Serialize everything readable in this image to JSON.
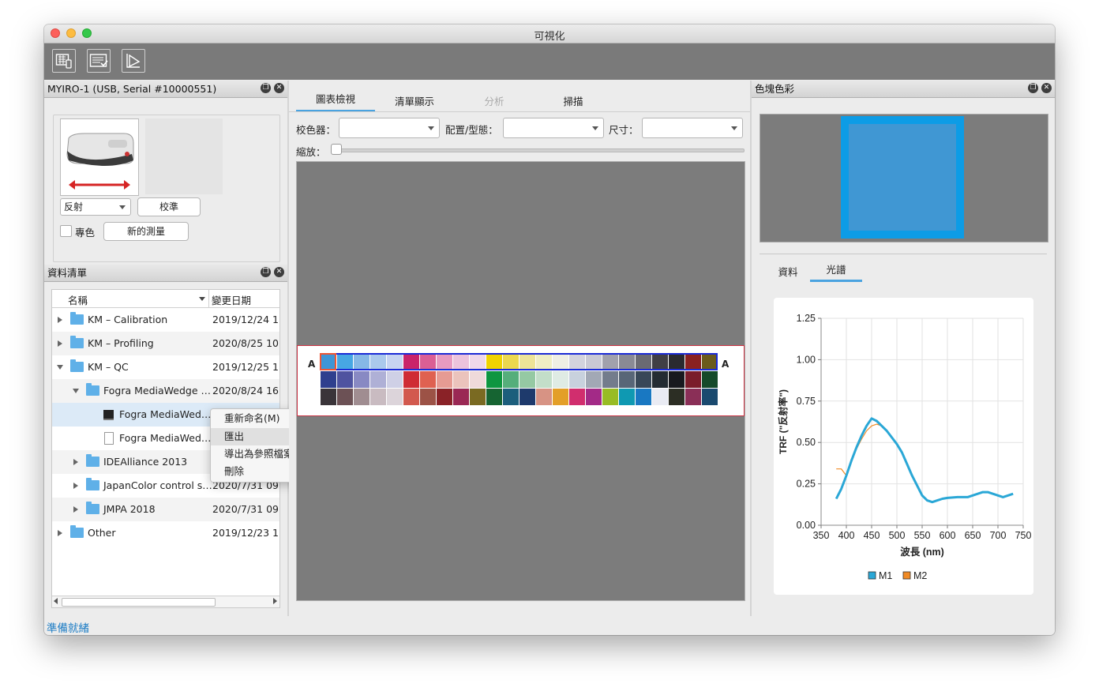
{
  "window": {
    "title": "可視化"
  },
  "device_panel": {
    "title": "MYIRO-1 (USB, Serial #10000551)",
    "mode_value": "反射",
    "calibrate_label": "校準",
    "spot_color_label": "專色",
    "new_measure_label": "新的測量"
  },
  "data_list": {
    "title": "資料清單",
    "col_name": "名稱",
    "col_date": "變更日期",
    "rows": [
      {
        "name": "KM – Calibration",
        "date": "2019/12/24 1"
      },
      {
        "name": "KM – Profiling",
        "date": "2020/8/25 10"
      },
      {
        "name": "KM – QC",
        "date": "2019/12/25 1"
      },
      {
        "name": "Fogra MediaWedge …",
        "date": "2020/8/24 16"
      },
      {
        "name": "Fogra MediaWed…",
        "date": ""
      },
      {
        "name": "Fogra MediaWed…",
        "date": ""
      },
      {
        "name": "IDEAlliance 2013",
        "date": ""
      },
      {
        "name": "JapanColor control s…",
        "date": "2020/7/31 09"
      },
      {
        "name": "JMPA 2018",
        "date": "2020/7/31 09"
      },
      {
        "name": "Other",
        "date": "2019/12/23 1"
      }
    ]
  },
  "context_menu": {
    "items": [
      "重新命名(M)",
      "匯出",
      "導出為參照檔案",
      "刪除"
    ]
  },
  "center": {
    "tabs": [
      "圖表檢視",
      "清單顯示",
      "分析",
      "掃描"
    ],
    "colorimeter_label": "校色器：",
    "layout_label": "配置/型態：",
    "size_label": "尺寸：",
    "zoom_label": "縮放：",
    "row_label": "A"
  },
  "patches": {
    "rows": [
      [
        "#3f96d6",
        "#47a7e3",
        "#86b8e6",
        "#abc9ec",
        "#c7d4f1",
        "#c9246a",
        "#db5f94",
        "#e79ac0",
        "#ecc3dc",
        "#efd8ea",
        "#f0d300",
        "#ecd84e",
        "#ede497",
        "#efeec4",
        "#efefe4",
        "#d3d3dd",
        "#c9c9d4",
        "#a1a1ac",
        "#8a8a94",
        "#6a6a72",
        "#403f45",
        "#2a2a30",
        "#8a2121",
        "#6b5b1c"
      ],
      [
        "#2f3f8e",
        "#4f53a0",
        "#8889c3",
        "#afb0d6",
        "#cfd0e6",
        "#cf2b35",
        "#df6151",
        "#e69b93",
        "#ebc3bc",
        "#efdada",
        "#0e9640",
        "#55ae7b",
        "#95c9a3",
        "#c3dec9",
        "#dfebe4",
        "#c8d1dd",
        "#a2a8b5",
        "#737c8c",
        "#586677",
        "#384757",
        "#242c33",
        "#18191e",
        "#7a1d2a",
        "#154a2a"
      ],
      [
        "#3a3439",
        "#6c5155",
        "#a08d91",
        "#c9bbc1",
        "#dcd4da",
        "#d2594e",
        "#9c5246",
        "#8a2227",
        "#9a2854",
        "#7a6a22",
        "#166432",
        "#1c5e7c",
        "#1e3a6c",
        "#d79384",
        "#e39f28",
        "#d12e6e",
        "#a32a87",
        "#98bc24",
        "#0f99b2",
        "#1978c2",
        "#e9ebf3",
        "#2c2e24",
        "#8a2f57",
        "#1a4a6f"
      ]
    ]
  },
  "right_panel": {
    "title": "色塊色彩",
    "swatch_color": "#4097d3",
    "swatch_border": "#0d9ce6",
    "tabs": [
      "資料",
      "光譜"
    ]
  },
  "chart_data": {
    "type": "line",
    "xlabel": "波長 (nm)",
    "ylabel": "TRF (\"反射率\")",
    "xlim": [
      350,
      750
    ],
    "ylim": [
      0,
      1.25
    ],
    "xticks": [
      "350",
      "400",
      "450",
      "500",
      "550",
      "600",
      "650",
      "700",
      "750"
    ],
    "yticks": [
      "0.00",
      "0.25",
      "0.50",
      "0.75",
      "1.00",
      "1.25"
    ],
    "series": [
      {
        "name": "M1",
        "color": "#2aa7d6",
        "x": [
          380,
          390,
          400,
          410,
          420,
          430,
          440,
          450,
          460,
          470,
          480,
          490,
          500,
          510,
          520,
          530,
          540,
          550,
          560,
          570,
          580,
          590,
          600,
          620,
          640,
          660,
          670,
          680,
          700,
          710,
          730
        ],
        "y": [
          0.16,
          0.22,
          0.3,
          0.39,
          0.47,
          0.54,
          0.6,
          0.645,
          0.63,
          0.6,
          0.57,
          0.53,
          0.49,
          0.44,
          0.37,
          0.3,
          0.24,
          0.18,
          0.15,
          0.14,
          0.15,
          0.16,
          0.165,
          0.17,
          0.17,
          0.19,
          0.2,
          0.2,
          0.18,
          0.17,
          0.19
        ]
      },
      {
        "name": "M2",
        "color": "#f08a24",
        "x": [
          380,
          390,
          400,
          410,
          420,
          430,
          440,
          450,
          460,
          470,
          480,
          490,
          500
        ],
        "y": [
          0.34,
          0.34,
          0.3,
          0.4,
          0.46,
          0.52,
          0.57,
          0.6,
          0.61,
          0.6,
          0.57,
          0.53,
          0.49
        ]
      }
    ]
  },
  "status": {
    "text": "準備就緒"
  }
}
